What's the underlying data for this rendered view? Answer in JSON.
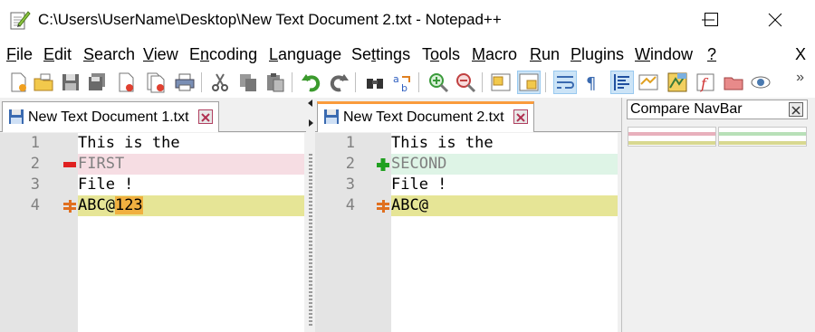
{
  "window": {
    "title": "C:\\Users\\UserName\\Desktop\\New Text Document 2.txt - Notepad++",
    "icon": "notepadpp-icon",
    "controls": [
      "minimize",
      "maximize",
      "close"
    ]
  },
  "menu": {
    "items": [
      {
        "acc": "F",
        "rest": "ile"
      },
      {
        "acc": "E",
        "rest": "dit"
      },
      {
        "acc": "S",
        "rest": "earch"
      },
      {
        "acc": "V",
        "rest": "iew"
      },
      {
        "acc": "E",
        "rest": "ncoding",
        "full": "Encoding"
      },
      {
        "acc": "L",
        "rest": "anguage"
      },
      {
        "acc": "S",
        "rest": "ettings",
        "pre": "Se",
        "post": "ttings"
      },
      {
        "acc": "T",
        "rest": "ools",
        "pre": "T",
        "post": "ools"
      },
      {
        "acc": "M",
        "rest": "acro"
      },
      {
        "acc": "R",
        "rest": "un"
      },
      {
        "acc": "P",
        "rest": "lugins"
      },
      {
        "acc": "W",
        "rest": "indow"
      },
      {
        "acc": "?",
        "rest": ""
      }
    ],
    "close_label": "X"
  },
  "toolbar": {
    "buttons": [
      "new-file",
      "open-file",
      "save",
      "save-all",
      "close",
      "close-all",
      "print",
      "cut",
      "copy",
      "paste",
      "undo",
      "redo",
      "find",
      "replace",
      "zoom-in",
      "zoom-out",
      "sync-vertical",
      "sync-horizontal",
      "word-wrap",
      "show-all-chars",
      "indent-guide",
      "compare",
      "doc-map",
      "function-list",
      "folder-as-workspace",
      "monitoring"
    ],
    "more": "»"
  },
  "left_pane": {
    "tab": {
      "label": "New Text Document 1.txt"
    },
    "lines": [
      {
        "num": "1",
        "text": "This is the",
        "state": "normal"
      },
      {
        "num": "2",
        "text": "FIRST",
        "state": "removed"
      },
      {
        "num": "3",
        "text": "File !",
        "state": "normal"
      },
      {
        "num": "4",
        "text": "ABC@",
        "highlight": "123",
        "state": "changed"
      }
    ]
  },
  "right_pane": {
    "tab": {
      "label": "New Text Document 2.txt"
    },
    "lines": [
      {
        "num": "1",
        "text": "This is the",
        "state": "normal"
      },
      {
        "num": "2",
        "text": "SECOND",
        "state": "added"
      },
      {
        "num": "3",
        "text": "File !",
        "state": "normal"
      },
      {
        "num": "4",
        "text": "ABC@",
        "state": "changed"
      }
    ]
  },
  "navbar": {
    "title": "Compare NavBar"
  },
  "colors": {
    "removed_bg": "#f6dde3",
    "added_bg": "#def4e6",
    "changed_bg": "#e6e596",
    "changed_highlight": "#f0b040",
    "active_tab_accent": "#fa9b3c"
  }
}
